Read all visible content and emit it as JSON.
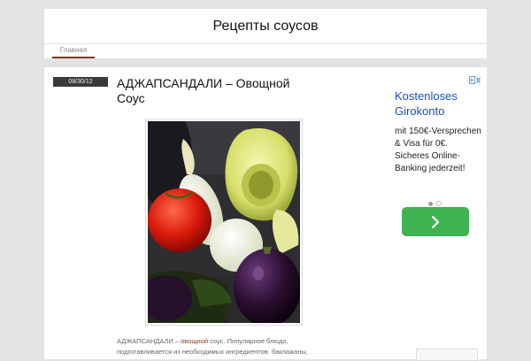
{
  "site": {
    "title": "Рецепты соусов"
  },
  "nav": {
    "items": [
      {
        "label": "Главная"
      }
    ]
  },
  "post": {
    "date": "08/30/12",
    "title": "АДЖАПСАНДАЛИ – Овощной Соус",
    "excerpt": {
      "part1": "АДЖАПСАНДАЛИ – ",
      "link": "овощной",
      "part2": " соус. Популярное блюдо,",
      "line2": "подготавливается из необходимых ингредиентов: баклажаны,"
    }
  },
  "ad": {
    "headline": "Kostenloses Girokonto",
    "body": "mit 150€-Versprechen & Visa für 0€. Sicheres Online-Banking jederzeit!",
    "button_icon": "chevron-right-icon",
    "adchoices_icon": "adchoices-icon",
    "button_color": "#3fb34f"
  },
  "colors": {
    "background": "#e3e3e3",
    "accent": "#7a3a1a",
    "date_badge": "#3a3a3a",
    "ad_link": "#1a4fc0"
  }
}
